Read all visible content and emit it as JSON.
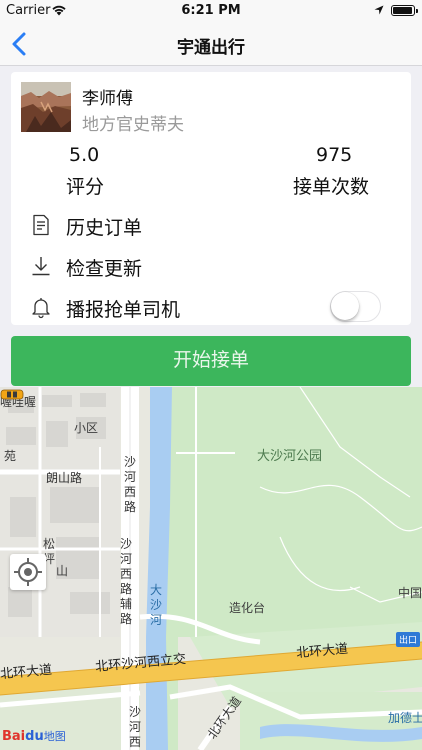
{
  "status_bar": {
    "carrier": "Carrier",
    "time": "6:21 PM"
  },
  "nav": {
    "title": "宇通出行",
    "back_icon": "chevron-left-icon"
  },
  "driver": {
    "name": "李师傅",
    "subtitle": "地方官史蒂夫"
  },
  "stats": {
    "score_value": "5.0",
    "score_label": "评分",
    "orders_value": "975",
    "orders_label": "接单次数"
  },
  "menu": [
    {
      "label": "历史订单",
      "icon": "document-icon"
    },
    {
      "label": "检查更新",
      "icon": "download-icon"
    },
    {
      "label": "播报抢单司机",
      "icon": "bell-icon",
      "toggle_on": false
    }
  ],
  "start_button": {
    "label": "开始接单",
    "color": "#3cb65c"
  },
  "map": {
    "labels": {
      "wowo": "喔哇喔",
      "xiaoqu": "小区",
      "yuan": "苑",
      "langshan": "朗山路",
      "shahe_west": "沙河西路",
      "shahe_west_aux": "沙河西路辅路",
      "songping": "松坪",
      "shan": "山",
      "dashahe_park": "大沙河公园",
      "dashahe": "大沙河",
      "zaohuatai": "造化台",
      "zhongguo": "中国",
      "exit": "出口",
      "beihuan_left": "北环大道",
      "beihuan_interchange": "北环沙河西立交",
      "beihuan_right": "北环大道",
      "shahe_west_bottom": "沙河西路",
      "beihuan_bottom": "北环大道",
      "jiade": "加德士"
    },
    "logo": {
      "bai": "Bai",
      "du": "du",
      "ditu": "地图"
    }
  }
}
